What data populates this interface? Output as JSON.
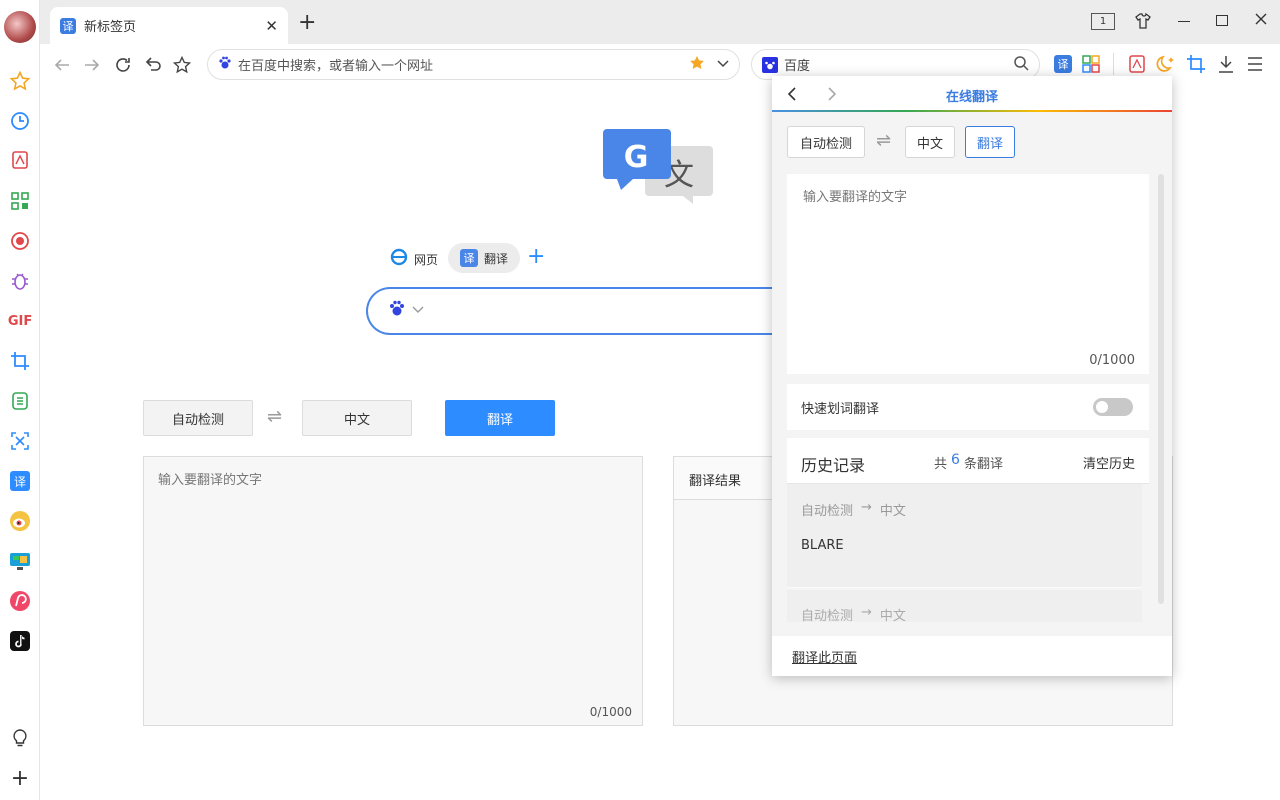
{
  "browser": {
    "tab": {
      "title": "新标签页",
      "favicon_char": "译",
      "close": "✕"
    },
    "new_tab": "+",
    "window_controls": {
      "tab_count": "1"
    },
    "address_bar": {
      "placeholder": "在百度中搜索，或者输入一个网址"
    },
    "search_box": {
      "engine_label": "百度"
    }
  },
  "page": {
    "search_tabs": [
      {
        "label": "网页"
      },
      {
        "label": "翻译"
      }
    ],
    "translate": {
      "source_lang": "自动检测",
      "swap": "⇌",
      "target_lang": "中文",
      "translate_button": "翻译",
      "input_placeholder": "输入要翻译的文字",
      "char_count": "0/1000",
      "result_label": "翻译结果"
    }
  },
  "popup": {
    "title": "在线翻译",
    "source_lang": "自动检测",
    "swap": "⇌",
    "target_lang": "中文",
    "translate_button": "翻译",
    "input_placeholder": "输入要翻译的文字",
    "char_count": "0/1000",
    "quick_translate_label": "快速划词翻译",
    "quick_translate_enabled": false,
    "history": {
      "title": "历史记录",
      "count_prefix": "共",
      "count": "6",
      "count_suffix": "条翻译",
      "clear": "清空历史",
      "items": [
        {
          "from": "自动检测",
          "arrow": "→",
          "to": "中文",
          "text": "BLARE"
        },
        {
          "from": "自动检测",
          "arrow": "→",
          "to": "中文",
          "text": ""
        }
      ]
    },
    "translate_page_link": "翻译此页面"
  },
  "sidebar": {
    "gif_label": "GIF",
    "translate_char": "译"
  },
  "colors": {
    "accent": "#2d8cff",
    "popup_accent": "#3a7ce0",
    "history_count": "#3a7ce0"
  }
}
